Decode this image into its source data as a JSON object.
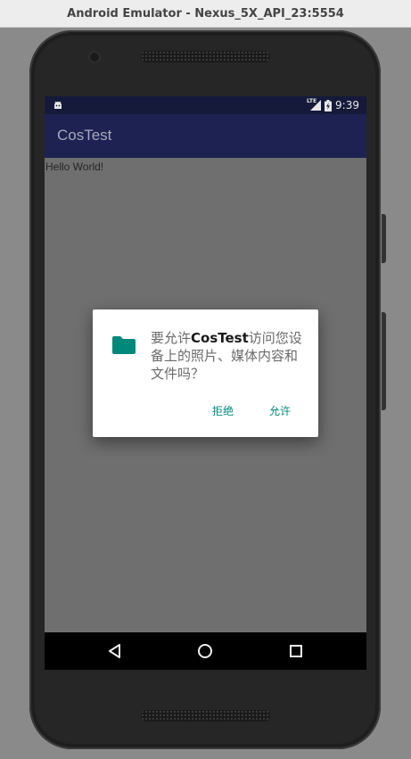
{
  "window": {
    "title": "Android Emulator - Nexus_5X_API_23:5554"
  },
  "statusbar": {
    "left_icon": "android-debug-icon",
    "network": "LTE",
    "time": "9:39",
    "icons": [
      "signal-icon",
      "battery-charging-icon"
    ]
  },
  "app": {
    "title": "CosTest",
    "body_text": "Hello World!"
  },
  "dialog": {
    "icon": "folder-icon",
    "message_prefix": "要允许",
    "app_name": "CosTest",
    "message_suffix": "访问您设备上的照片、媒体内容和文件吗？",
    "deny_label": "拒绝",
    "allow_label": "允许",
    "accent_color": "#00897b"
  },
  "navbar": {
    "buttons": [
      "back-icon",
      "home-icon",
      "recents-icon"
    ]
  },
  "colors": {
    "toolbar": "#1d2253",
    "statusbar": "#151a3a",
    "screen_bg": "#6f6f6f"
  }
}
